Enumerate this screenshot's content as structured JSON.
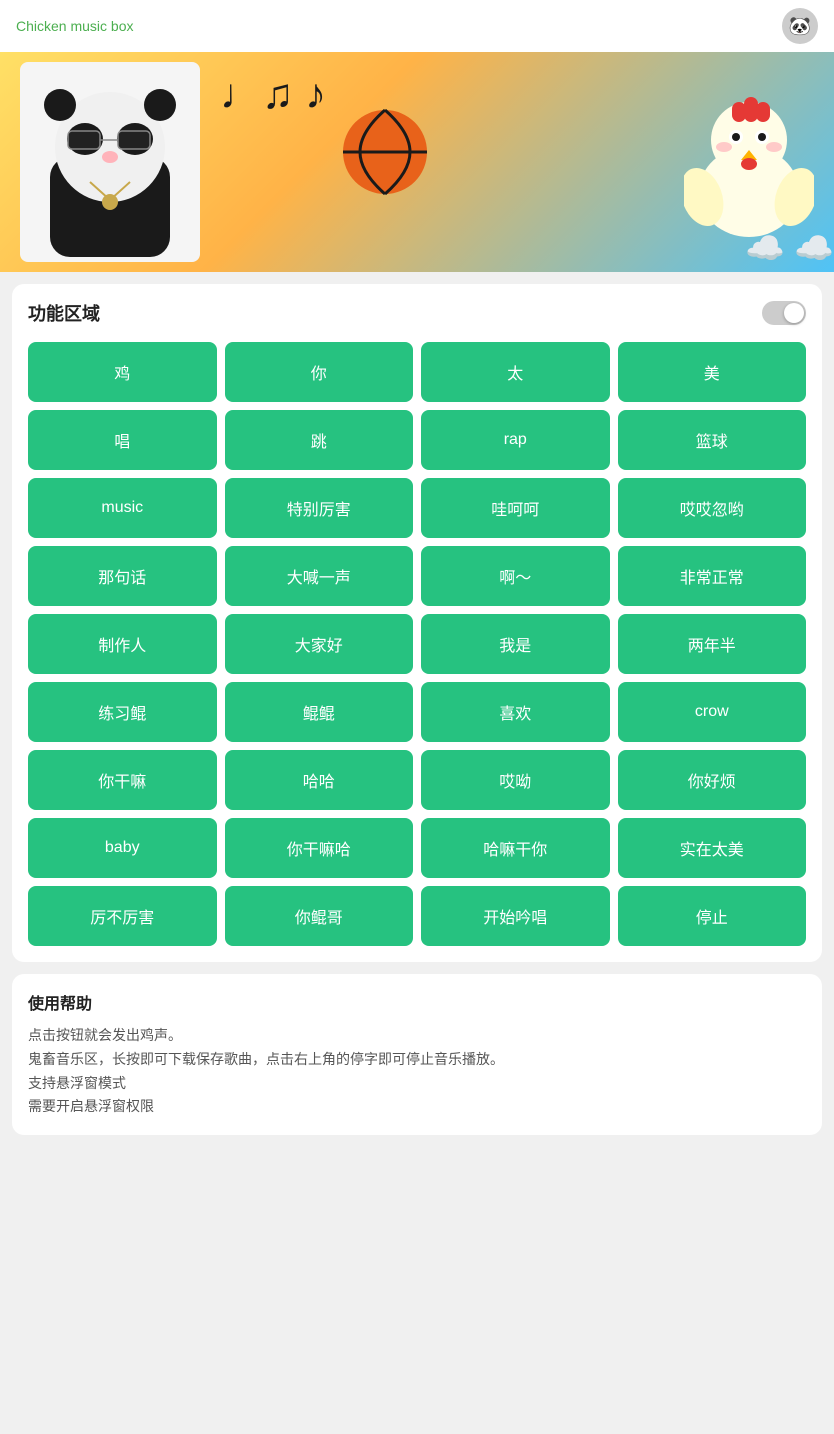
{
  "header": {
    "title": "Chicken music box",
    "avatar_emoji": "🐼"
  },
  "banner": {
    "notes": "♩♫♪",
    "panda_emoji": "🐼",
    "basketball_emoji": "🏀",
    "chicken_emoji": "🐔",
    "cloud_emoji": "☁️"
  },
  "function_section": {
    "title": "功能区域",
    "toggle_active": false
  },
  "buttons": [
    "鸡",
    "你",
    "太",
    "美",
    "唱",
    "跳",
    "rap",
    "篮球",
    "music",
    "特别厉害",
    "哇呵呵",
    "哎哎忽哟",
    "那句话",
    "大喊一声",
    "啊～",
    "非常正常",
    "制作人",
    "大家好",
    "我是",
    "两年半",
    "练习鲲",
    "鲲鲲",
    "喜欢",
    "crow",
    "你干嘛",
    "哈哈",
    "哎呦",
    "你好烦",
    "baby",
    "你干嘛哈",
    "哈嘛干你",
    "实在太美",
    "厉不厉害",
    "你鲲哥",
    "开始吟唱",
    "停止"
  ],
  "help": {
    "title": "使用帮助",
    "lines": [
      "点击按钮就会发出鸡声。",
      "鬼畜音乐区，长按即可下载保存歌曲，点击右上角的停字即可停止音乐播放。",
      "支持悬浮窗模式",
      "需要开启悬浮窗权限"
    ]
  }
}
